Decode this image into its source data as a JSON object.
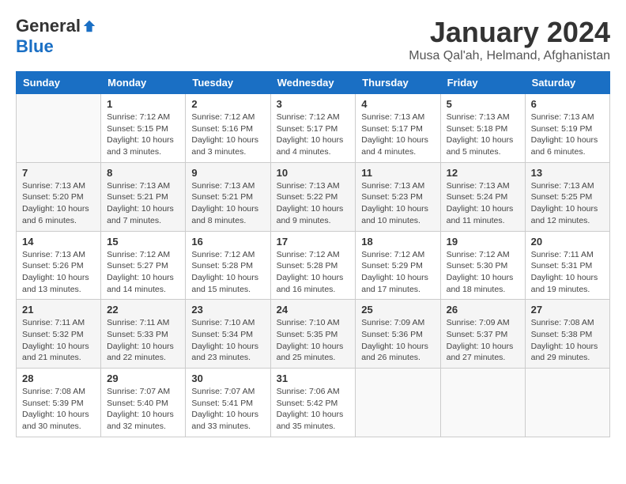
{
  "logo": {
    "general": "General",
    "blue": "Blue"
  },
  "title": "January 2024",
  "location": "Musa Qal'ah, Helmand, Afghanistan",
  "days_of_week": [
    "Sunday",
    "Monday",
    "Tuesday",
    "Wednesday",
    "Thursday",
    "Friday",
    "Saturday"
  ],
  "weeks": [
    [
      {
        "day": "",
        "info": ""
      },
      {
        "day": "1",
        "info": "Sunrise: 7:12 AM\nSunset: 5:15 PM\nDaylight: 10 hours\nand 3 minutes."
      },
      {
        "day": "2",
        "info": "Sunrise: 7:12 AM\nSunset: 5:16 PM\nDaylight: 10 hours\nand 3 minutes."
      },
      {
        "day": "3",
        "info": "Sunrise: 7:12 AM\nSunset: 5:17 PM\nDaylight: 10 hours\nand 4 minutes."
      },
      {
        "day": "4",
        "info": "Sunrise: 7:13 AM\nSunset: 5:17 PM\nDaylight: 10 hours\nand 4 minutes."
      },
      {
        "day": "5",
        "info": "Sunrise: 7:13 AM\nSunset: 5:18 PM\nDaylight: 10 hours\nand 5 minutes."
      },
      {
        "day": "6",
        "info": "Sunrise: 7:13 AM\nSunset: 5:19 PM\nDaylight: 10 hours\nand 6 minutes."
      }
    ],
    [
      {
        "day": "7",
        "info": "Sunrise: 7:13 AM\nSunset: 5:20 PM\nDaylight: 10 hours\nand 6 minutes."
      },
      {
        "day": "8",
        "info": "Sunrise: 7:13 AM\nSunset: 5:21 PM\nDaylight: 10 hours\nand 7 minutes."
      },
      {
        "day": "9",
        "info": "Sunrise: 7:13 AM\nSunset: 5:21 PM\nDaylight: 10 hours\nand 8 minutes."
      },
      {
        "day": "10",
        "info": "Sunrise: 7:13 AM\nSunset: 5:22 PM\nDaylight: 10 hours\nand 9 minutes."
      },
      {
        "day": "11",
        "info": "Sunrise: 7:13 AM\nSunset: 5:23 PM\nDaylight: 10 hours\nand 10 minutes."
      },
      {
        "day": "12",
        "info": "Sunrise: 7:13 AM\nSunset: 5:24 PM\nDaylight: 10 hours\nand 11 minutes."
      },
      {
        "day": "13",
        "info": "Sunrise: 7:13 AM\nSunset: 5:25 PM\nDaylight: 10 hours\nand 12 minutes."
      }
    ],
    [
      {
        "day": "14",
        "info": "Sunrise: 7:13 AM\nSunset: 5:26 PM\nDaylight: 10 hours\nand 13 minutes."
      },
      {
        "day": "15",
        "info": "Sunrise: 7:12 AM\nSunset: 5:27 PM\nDaylight: 10 hours\nand 14 minutes."
      },
      {
        "day": "16",
        "info": "Sunrise: 7:12 AM\nSunset: 5:28 PM\nDaylight: 10 hours\nand 15 minutes."
      },
      {
        "day": "17",
        "info": "Sunrise: 7:12 AM\nSunset: 5:28 PM\nDaylight: 10 hours\nand 16 minutes."
      },
      {
        "day": "18",
        "info": "Sunrise: 7:12 AM\nSunset: 5:29 PM\nDaylight: 10 hours\nand 17 minutes."
      },
      {
        "day": "19",
        "info": "Sunrise: 7:12 AM\nSunset: 5:30 PM\nDaylight: 10 hours\nand 18 minutes."
      },
      {
        "day": "20",
        "info": "Sunrise: 7:11 AM\nSunset: 5:31 PM\nDaylight: 10 hours\nand 19 minutes."
      }
    ],
    [
      {
        "day": "21",
        "info": "Sunrise: 7:11 AM\nSunset: 5:32 PM\nDaylight: 10 hours\nand 21 minutes."
      },
      {
        "day": "22",
        "info": "Sunrise: 7:11 AM\nSunset: 5:33 PM\nDaylight: 10 hours\nand 22 minutes."
      },
      {
        "day": "23",
        "info": "Sunrise: 7:10 AM\nSunset: 5:34 PM\nDaylight: 10 hours\nand 23 minutes."
      },
      {
        "day": "24",
        "info": "Sunrise: 7:10 AM\nSunset: 5:35 PM\nDaylight: 10 hours\nand 25 minutes."
      },
      {
        "day": "25",
        "info": "Sunrise: 7:09 AM\nSunset: 5:36 PM\nDaylight: 10 hours\nand 26 minutes."
      },
      {
        "day": "26",
        "info": "Sunrise: 7:09 AM\nSunset: 5:37 PM\nDaylight: 10 hours\nand 27 minutes."
      },
      {
        "day": "27",
        "info": "Sunrise: 7:08 AM\nSunset: 5:38 PM\nDaylight: 10 hours\nand 29 minutes."
      }
    ],
    [
      {
        "day": "28",
        "info": "Sunrise: 7:08 AM\nSunset: 5:39 PM\nDaylight: 10 hours\nand 30 minutes."
      },
      {
        "day": "29",
        "info": "Sunrise: 7:07 AM\nSunset: 5:40 PM\nDaylight: 10 hours\nand 32 minutes."
      },
      {
        "day": "30",
        "info": "Sunrise: 7:07 AM\nSunset: 5:41 PM\nDaylight: 10 hours\nand 33 minutes."
      },
      {
        "day": "31",
        "info": "Sunrise: 7:06 AM\nSunset: 5:42 PM\nDaylight: 10 hours\nand 35 minutes."
      },
      {
        "day": "",
        "info": ""
      },
      {
        "day": "",
        "info": ""
      },
      {
        "day": "",
        "info": ""
      }
    ]
  ]
}
